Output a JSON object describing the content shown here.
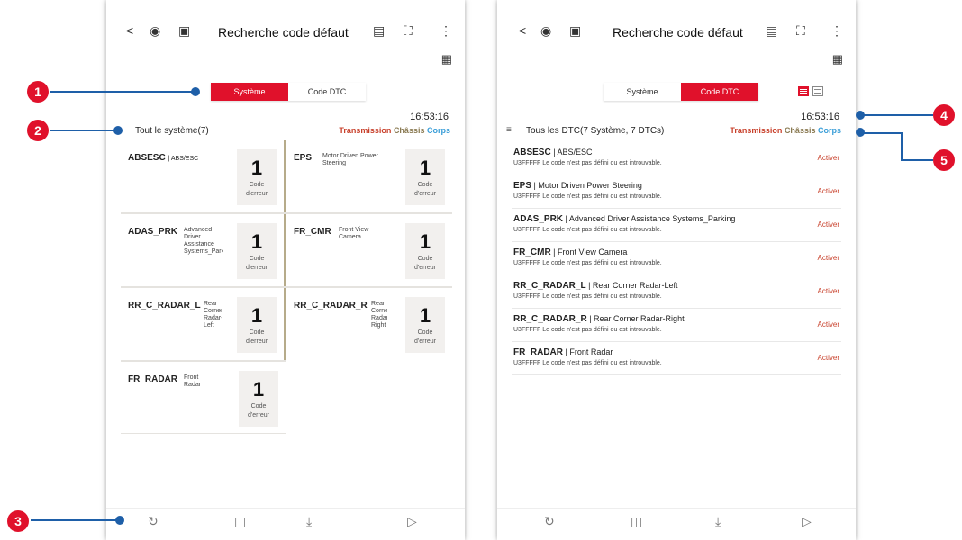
{
  "topbar": {
    "back_icon": "<",
    "title": "Recherche code défaut",
    "menu_icon": "⋮"
  },
  "left_screen": {
    "tabs": [
      {
        "label": "Système",
        "active": true
      },
      {
        "label": "Code DTC",
        "active": false
      }
    ],
    "time": "16:53:16",
    "filter_label": "Tout le système(7)",
    "categories": [
      "Transmission",
      "Châssis",
      "Corps"
    ],
    "cards": [
      {
        "name": "ABSESC",
        "desc": "ABS/ESC",
        "count": "1",
        "count_label_1": "Code",
        "count_label_2": "d'erreur"
      },
      {
        "name": "EPS",
        "desc": "Motor Driven Power Steering",
        "count": "1",
        "count_label_1": "Code",
        "count_label_2": "d'erreur"
      },
      {
        "name": "ADAS_PRK",
        "desc": "Advanced Driver Assistance Systems_Parking",
        "count": "1",
        "count_label_1": "Code",
        "count_label_2": "d'erreur"
      },
      {
        "name": "FR_CMR",
        "desc": "Front View Camera",
        "count": "1",
        "count_label_1": "Code",
        "count_label_2": "d'erreur"
      },
      {
        "name": "RR_C_RADAR_L",
        "desc": "Rear Corner Radar-Left",
        "count": "1",
        "count_label_1": "Code",
        "count_label_2": "d'erreur"
      },
      {
        "name": "RR_C_RADAR_R",
        "desc": "Rear Corner Radar-Right",
        "count": "1",
        "count_label_1": "Code",
        "count_label_2": "d'erreur"
      },
      {
        "name": "FR_RADAR",
        "desc": "Front Radar",
        "count": "1",
        "count_label_1": "Code",
        "count_label_2": "d'erreur"
      }
    ]
  },
  "right_screen": {
    "tabs": [
      {
        "label": "Système",
        "active": false
      },
      {
        "label": "Code DTC",
        "active": true
      }
    ],
    "time": "16:53:16",
    "filter_label": "Tous les DTC(7 Système, 7 DTCs)",
    "categories": [
      "Transmission",
      "Châssis",
      "Corps"
    ],
    "dtcs": [
      {
        "system": "ABSESC",
        "desc": "ABS/ESC",
        "code_text": "U3FFFFF Le code n'est pas défini ou est introuvable.",
        "action": "Activer"
      },
      {
        "system": "EPS",
        "desc": "Motor Driven Power Steering",
        "code_text": "U3FFFFF Le code n'est pas défini ou est introuvable.",
        "action": "Activer"
      },
      {
        "system": "ADAS_PRK",
        "desc": "Advanced Driver Assistance Systems_Parking",
        "code_text": "U3FFFFF Le code n'est pas défini ou est introuvable.",
        "action": "Activer"
      },
      {
        "system": "FR_CMR",
        "desc": "Front View Camera",
        "code_text": "U3FFFFF Le code n'est pas défini ou est introuvable.",
        "action": "Activer"
      },
      {
        "system": "RR_C_RADAR_L",
        "desc": "Rear Corner Radar-Left",
        "code_text": "U3FFFFF Le code n'est pas défini ou est introuvable.",
        "action": "Activer"
      },
      {
        "system": "RR_C_RADAR_R",
        "desc": "Rear Corner Radar-Right",
        "code_text": "U3FFFFF Le code n'est pas défini ou est introuvable.",
        "action": "Activer"
      },
      {
        "system": "FR_RADAR",
        "desc": "Front Radar",
        "code_text": "U3FFFFF Le code n'est pas défini ou est introuvable.",
        "action": "Activer"
      }
    ]
  },
  "callouts": [
    "1",
    "2",
    "3",
    "4",
    "5"
  ],
  "colors": {
    "accent": "#e0112b",
    "transmission": "#c8402b",
    "chassis": "#8a7a52",
    "corps": "#3a9ed8",
    "callout_line": "#1e5fa8"
  },
  "icons": [
    "back-icon",
    "vehicle-scan-icon",
    "vehicle-upload-icon",
    "report-icon",
    "fullscreen-icon",
    "more-icon",
    "car-settings-icon",
    "filter-icon",
    "refresh-icon",
    "delete-icon",
    "download-icon",
    "play-file-icon"
  ]
}
